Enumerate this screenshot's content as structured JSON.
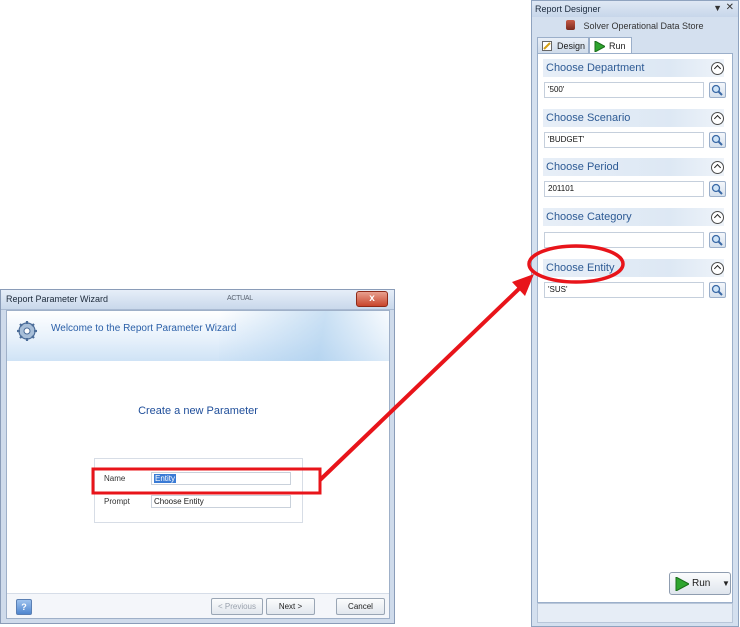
{
  "wizard": {
    "title": "Report Parameter Wizard",
    "title_center": "ACTUAL",
    "close_label": "x",
    "welcome": "Welcome to the Report Parameter Wizard",
    "heading": "Create a new Parameter",
    "fields": {
      "name_label": "Name",
      "name_value": "Entity",
      "prompt_label": "Prompt",
      "prompt_value": "Choose Entity"
    },
    "footer": {
      "help_label": "?",
      "previous_label": "< Previous",
      "next_label": "Next >",
      "cancel_label": "Cancel"
    }
  },
  "designer": {
    "title": "Report Designer",
    "pin_label": "▼",
    "close_label": "✕",
    "data_source": "Solver Operational Data Store",
    "tabs": [
      {
        "label": "Design",
        "icon": "design-icon"
      },
      {
        "label": "Run",
        "icon": "play-icon"
      }
    ],
    "active_tab": "Run",
    "parameters": [
      {
        "title": "Choose Department",
        "value": "'500'"
      },
      {
        "title": "Choose Scenario",
        "value": "'BUDGET'"
      },
      {
        "title": "Choose Period",
        "value": "201101"
      },
      {
        "title": "Choose Category",
        "value": ""
      },
      {
        "title": "Choose Entity",
        "value": "'SUS'"
      }
    ],
    "run_button": {
      "label": "Run",
      "icon": "play-icon"
    }
  },
  "annotation": {
    "color": "#e8141a",
    "type": "red highlight box linked by arrow to red ellipse"
  }
}
